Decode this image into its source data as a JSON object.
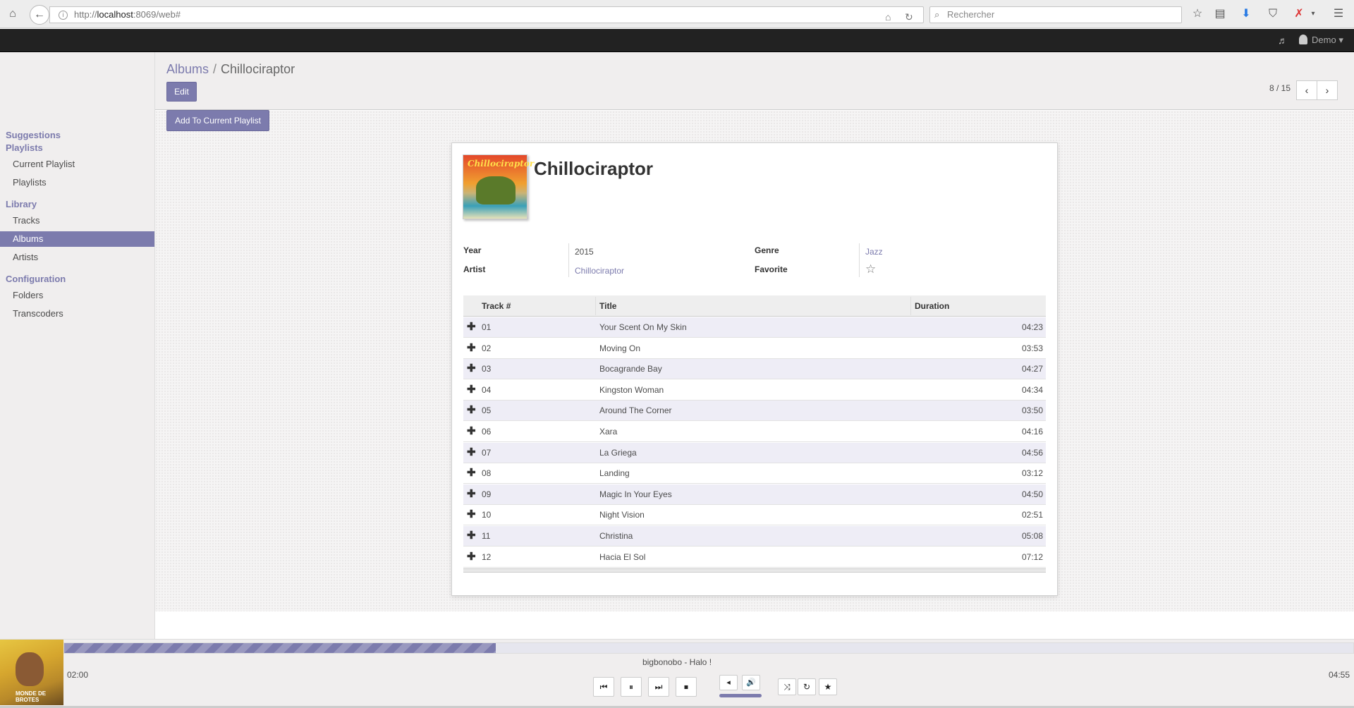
{
  "browser": {
    "url_prefix": "http://",
    "url_host": "localhost",
    "url_rest": ":8069/web#",
    "search_placeholder": "Rechercher"
  },
  "topbar": {
    "user_name": "Demo"
  },
  "sidebar": {
    "sections": [
      {
        "title": "Suggestions Playlists",
        "items": [
          "Current Playlist",
          "Playlists"
        ]
      },
      {
        "title": "Library",
        "items": [
          "Tracks",
          "Albums",
          "Artists"
        ]
      },
      {
        "title": "Configuration",
        "items": [
          "Folders",
          "Transcoders"
        ]
      }
    ],
    "active_item": "Albums"
  },
  "control_panel": {
    "breadcrumb_parent": "Albums",
    "breadcrumb_separator": "/",
    "breadcrumb_current": "Chillociraptor",
    "edit_label": "Edit",
    "add_playlist_label": "Add To Current Playlist",
    "pager": "8 / 15"
  },
  "album": {
    "title": "Chillociraptor",
    "cover_text": "Chillociraptor",
    "fields": {
      "year_label": "Year",
      "year": "2015",
      "artist_label": "Artist",
      "artist": "Chillociraptor",
      "genre_label": "Genre",
      "genre": "Jazz",
      "favorite_label": "Favorite",
      "favorite": false
    },
    "columns": [
      "Track #",
      "Title",
      "Duration"
    ],
    "tracks": [
      {
        "num": "01",
        "title": "Your Scent On My Skin",
        "duration": "04:23"
      },
      {
        "num": "02",
        "title": "Moving On",
        "duration": "03:53"
      },
      {
        "num": "03",
        "title": "Bocagrande Bay",
        "duration": "04:27"
      },
      {
        "num": "04",
        "title": "Kingston Woman",
        "duration": "04:34"
      },
      {
        "num": "05",
        "title": "Around The Corner",
        "duration": "03:50"
      },
      {
        "num": "06",
        "title": "Xara",
        "duration": "04:16"
      },
      {
        "num": "07",
        "title": "La Griega",
        "duration": "04:56"
      },
      {
        "num": "08",
        "title": "Landing",
        "duration": "03:12"
      },
      {
        "num": "09",
        "title": "Magic In Your Eyes",
        "duration": "04:50"
      },
      {
        "num": "10",
        "title": "Night Vision",
        "duration": "02:51"
      },
      {
        "num": "11",
        "title": "Christina",
        "duration": "05:08"
      },
      {
        "num": "12",
        "title": "Hacia El Sol",
        "duration": "07:12"
      }
    ]
  },
  "player": {
    "now_playing": "bigbonobo - Halo !",
    "elapsed": "02:00",
    "total": "04:55",
    "progress_fraction": 0.335,
    "cover_text": "MONDE DE BROTES"
  },
  "colors": {
    "accent": "#7c7bad",
    "topbar": "#222222",
    "sidebar_bg": "#f0eeee"
  }
}
